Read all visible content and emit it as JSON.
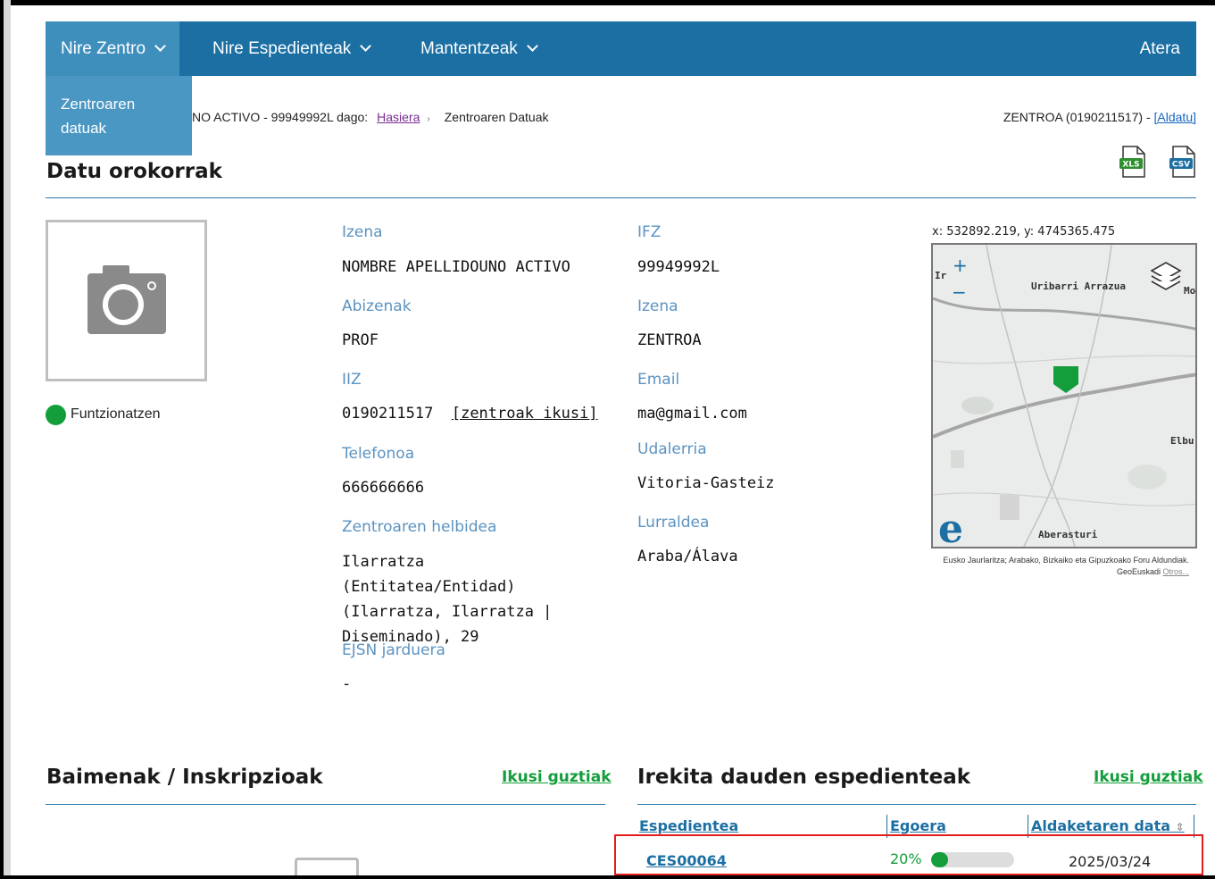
{
  "nav": {
    "items": [
      {
        "label": "Nire Zentro"
      },
      {
        "label": "Nire Espedienteak"
      },
      {
        "label": "Mantentzeak"
      }
    ],
    "exit": "Atera",
    "dropdown": {
      "item": "Zentroaren datuak"
    }
  },
  "breadcrumb": {
    "prefix": "NO ACTIVO - 99949992L dago:",
    "home": "Hasiera",
    "separator": "›",
    "current": "Zentroaren Datuak"
  },
  "center": {
    "info": "ZENTROA (0190211517) - ",
    "change": "[Aldatu]"
  },
  "export": {
    "xls": "XLS",
    "csv": "CSV"
  },
  "general": {
    "title": "Datu orokorrak",
    "status": "Funtzionatzen",
    "status_color": "#149d3b",
    "name_label": "Izena",
    "name_value": "NOMBRE APELLIDOUNO ACTIVO",
    "surname_label": "Abizenak",
    "surname_value": "PROF",
    "iiz_label": "IIZ",
    "iiz_value": "0190211517",
    "iiz_link": "[zentroak ikusi]",
    "phone_label": "Telefonoa",
    "phone_value": "666666666",
    "address_label": "Zentroaren helbidea",
    "address_value": "Ilarratza (Entitatea/Entidad) (Ilarratza, Ilarratza | Diseminado), 29",
    "ejsn_label": "EJSN jarduera",
    "ejsn_value": "-",
    "ifz_label": "IFZ",
    "ifz_value": "99949992L",
    "center_name_label": "Izena",
    "center_name_value": "ZENTROA",
    "email_label": "Email",
    "email_value": "ma@gmail.com",
    "municipality_label": "Udalerria",
    "municipality_value": "Vitoria-Gasteiz",
    "territory_label": "Lurraldea",
    "territory_value": "Araba/Álava"
  },
  "map": {
    "coords": "x: 532892.219, y: 4745365.475",
    "zoom_in": "+",
    "zoom_out": "−",
    "place1": "Uribarri Arrazua",
    "place2": "Aberasturi",
    "place3": "Elbu",
    "place4": "Mo",
    "place5": "Ir",
    "logo": "e",
    "attribution": "Eusko Jaurlaritza; Arabako, Bizkaiko eta Gipuzkoako Foru Aldundiak. GeoEuskadi",
    "attribution_link": "Otros..."
  },
  "permits": {
    "title": "Baimenak / Inskripzioak",
    "see_all": "Ikusi guztiak"
  },
  "open_files": {
    "title": "Irekita dauden espedienteak",
    "see_all": "Ikusi guztiak",
    "columns": [
      "Espedientea",
      "Egoera",
      "Aldaketaren data"
    ],
    "sort_icon": "⇕",
    "rows": [
      {
        "file": "CES00064",
        "progress_label": "20%",
        "progress": 0.2,
        "date": "2025/03/24"
      }
    ]
  }
}
